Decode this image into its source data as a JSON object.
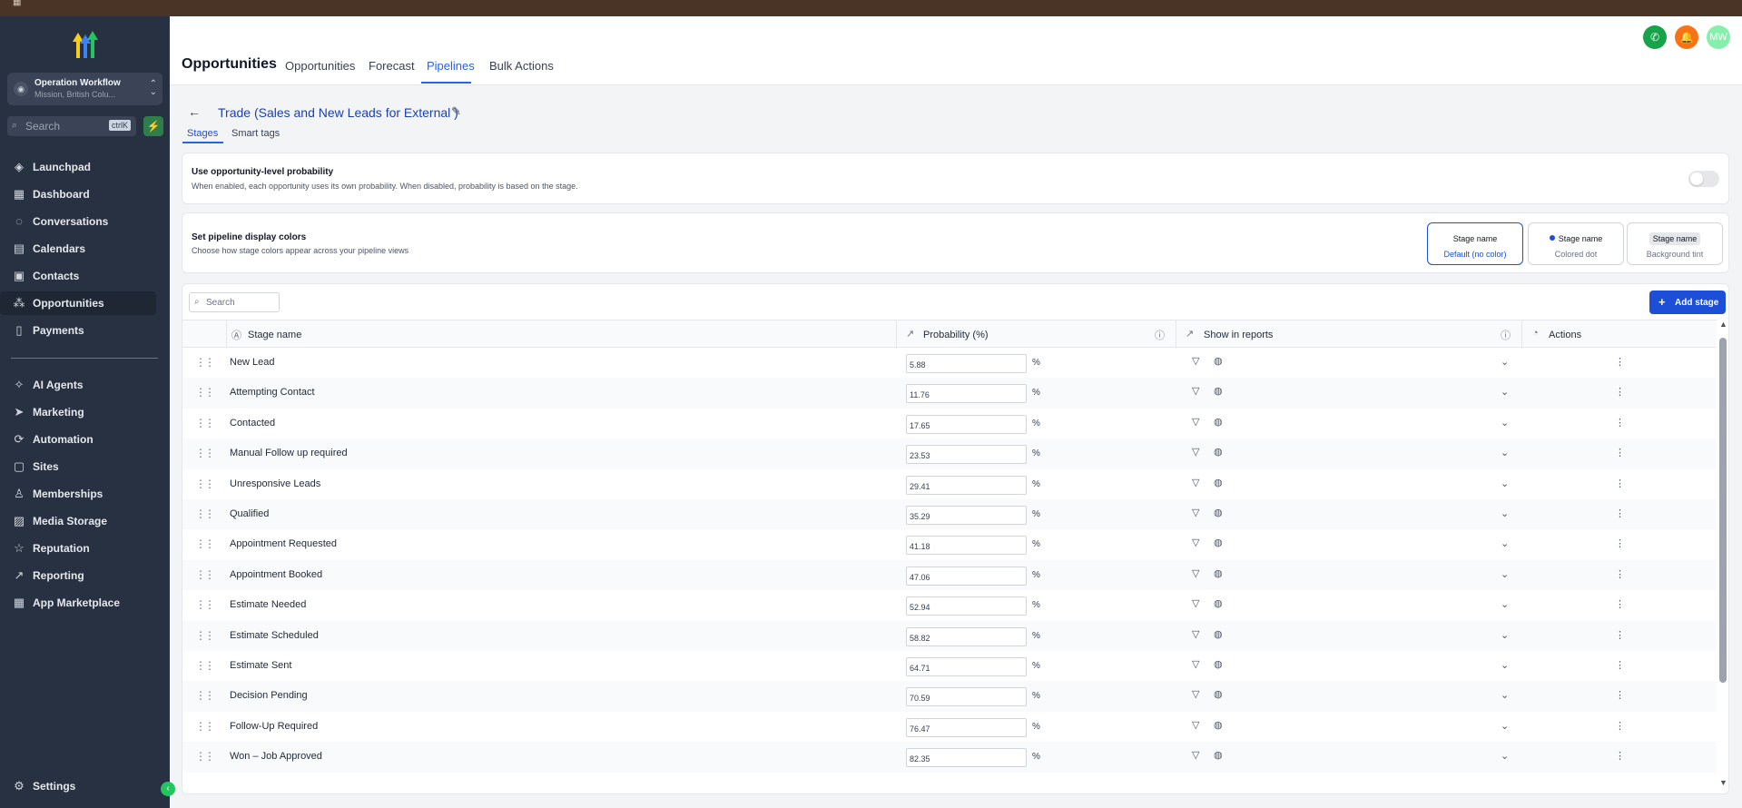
{
  "colors": {
    "accent": "#2563eb",
    "sidebar": "#273142",
    "topbar": "#4a3426",
    "call": "#16a34a",
    "notify": "#f97316",
    "avatar": "#22c55e"
  },
  "sidebar": {
    "account": {
      "name": "Operation Workflow",
      "location": "Mission, British Colu..."
    },
    "search": {
      "placeholder": "Search",
      "shortcut": "ctrlK"
    },
    "items": [
      {
        "label": "Launchpad",
        "icon": "launchpad-icon"
      },
      {
        "label": "Dashboard",
        "icon": "dashboard-icon"
      },
      {
        "label": "Conversations",
        "icon": "chat-icon"
      },
      {
        "label": "Calendars",
        "icon": "calendar-icon"
      },
      {
        "label": "Contacts",
        "icon": "contacts-icon"
      },
      {
        "label": "Opportunities",
        "icon": "opportunities-icon",
        "active": true
      },
      {
        "label": "Payments",
        "icon": "payments-icon"
      }
    ],
    "items2": [
      {
        "label": "AI Agents",
        "icon": "ai-agents-icon"
      },
      {
        "label": "Marketing",
        "icon": "send-icon"
      },
      {
        "label": "Automation",
        "icon": "automation-icon"
      },
      {
        "label": "Sites",
        "icon": "sites-icon"
      },
      {
        "label": "Memberships",
        "icon": "memberships-icon"
      },
      {
        "label": "Media Storage",
        "icon": "media-icon"
      },
      {
        "label": "Reputation",
        "icon": "star-icon"
      },
      {
        "label": "Reporting",
        "icon": "trend-icon"
      },
      {
        "label": "App Marketplace",
        "icon": "apps-icon"
      }
    ],
    "settings": "Settings"
  },
  "header": {
    "title": "Opportunities",
    "tabs": [
      "Opportunities",
      "Forecast",
      "Pipelines",
      "Bulk Actions"
    ],
    "active_tab": "Pipelines",
    "avatar_initials": "MW"
  },
  "pipeline": {
    "title": "Trade (Sales and New Leads for External )",
    "subtabs": [
      "Stages",
      "Smart tags"
    ]
  },
  "probability_card": {
    "title": "Use opportunity-level probability",
    "desc": "When enabled, each opportunity uses its own probability. When disabled, probability is based on the stage.",
    "enabled": false
  },
  "colors_card": {
    "title": "Set pipeline display colors",
    "desc": "Choose how stage colors appear across your pipeline views",
    "options": [
      {
        "name": "Stage name",
        "sub": "Default (no color)",
        "selected": true
      },
      {
        "name": "Stage name",
        "sub": "Colored dot"
      },
      {
        "name": "Stage name",
        "sub": "Background tint"
      }
    ]
  },
  "table": {
    "search_placeholder": "Search",
    "add_label": "Add stage",
    "columns": [
      "Stage name",
      "Probability (%)",
      "Show in reports",
      "Actions"
    ],
    "pct": "%",
    "rows": [
      {
        "name": "New Lead",
        "prob": "5.88"
      },
      {
        "name": "Attempting Contact",
        "prob": "11.76"
      },
      {
        "name": "Contacted",
        "prob": "17.65"
      },
      {
        "name": "Manual Follow up required",
        "prob": "23.53"
      },
      {
        "name": "Unresponsive Leads",
        "prob": "29.41"
      },
      {
        "name": "Qualified",
        "prob": "35.29"
      },
      {
        "name": "Appointment Requested",
        "prob": "41.18"
      },
      {
        "name": "Appointment Booked",
        "prob": "47.06"
      },
      {
        "name": "Estimate Needed",
        "prob": "52.94"
      },
      {
        "name": "Estimate Scheduled",
        "prob": "58.82"
      },
      {
        "name": "Estimate Sent",
        "prob": "64.71"
      },
      {
        "name": "Decision Pending",
        "prob": "70.59"
      },
      {
        "name": "Follow-Up Required",
        "prob": "76.47"
      },
      {
        "name": "Won – Job Approved",
        "prob": "82.35"
      }
    ]
  }
}
